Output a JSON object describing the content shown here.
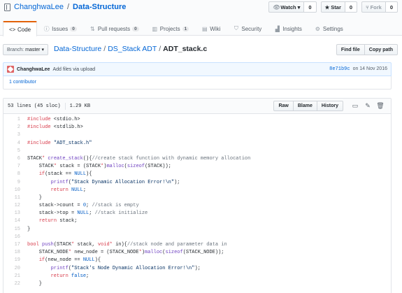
{
  "repo": {
    "owner": "ChanghwaLee",
    "separator": "/",
    "name": "Data-Structure"
  },
  "actions": {
    "watch": {
      "label": "Watch",
      "count": "0"
    },
    "star": {
      "label": "Star",
      "count": "0"
    },
    "fork": {
      "label": "Fork",
      "count": "0"
    }
  },
  "tabs": [
    {
      "label": "Code",
      "icon": "code-icon"
    },
    {
      "label": "Issues",
      "count": "0",
      "icon": "issue-icon"
    },
    {
      "label": "Pull requests",
      "count": "0",
      "icon": "pull-request-icon"
    },
    {
      "label": "Projects",
      "count": "1",
      "icon": "project-icon"
    },
    {
      "label": "Wiki",
      "icon": "book-icon"
    },
    {
      "label": "Security",
      "icon": "shield-icon"
    },
    {
      "label": "Insights",
      "icon": "graph-icon"
    },
    {
      "label": "Settings",
      "icon": "gear-icon"
    }
  ],
  "branch": {
    "prefix": "Branch:",
    "name": "master"
  },
  "breadcrumb": {
    "root": "Data-Structure",
    "folder": "DS_Stack ADT",
    "file": "ADT_stack.c",
    "sep": "/"
  },
  "file_buttons": {
    "find": "Find file",
    "copy": "Copy path"
  },
  "commit": {
    "author": "ChanghwaLee",
    "message": "Add files via upload",
    "sha": "8e71b9c",
    "date": "on 14 Nov 2016"
  },
  "contributors": "1 contributor",
  "file_info": {
    "lines": "53 lines (45 sloc)",
    "size": "1.29 KB"
  },
  "file_actions": {
    "raw": "Raw",
    "blame": "Blame",
    "history": "History"
  },
  "colors": {
    "link": "#0366d6",
    "keyword": "#d73a49",
    "function": "#6f42c1",
    "string": "#032f62",
    "comment": "#6a737d",
    "tab_accent": "#e36209"
  },
  "code_lines": [
    "#include <stdio.h>",
    "#include <stdlib.h>",
    "",
    "#include \"ADT_stack.h\"",
    "",
    "STACK* create_stack(){//create stack function with dynamic memory allocation",
    "    STACK* stack = (STACK*)malloc(sizeof(STACK));",
    "    if(stack == NULL){",
    "        printf(\"Stack Dynamic Allocation Error!\\n\");",
    "        return NULL;",
    "    }",
    "    stack->count = 0; //stack is empty",
    "    stack->top = NULL; //stack initialize",
    "    return stack;",
    "}",
    "",
    "bool push(STACK* stack, void* in){//stack node and parameter data in",
    "    STACK_NODE* new_node = (STACK_NODE*)malloc(sizeof(STACK_NODE));",
    "    if(new_node == NULL){",
    "        printf(\"Stack's Node Dynamic Allocation Error!\\n\");",
    "        return false;",
    "    }"
  ]
}
